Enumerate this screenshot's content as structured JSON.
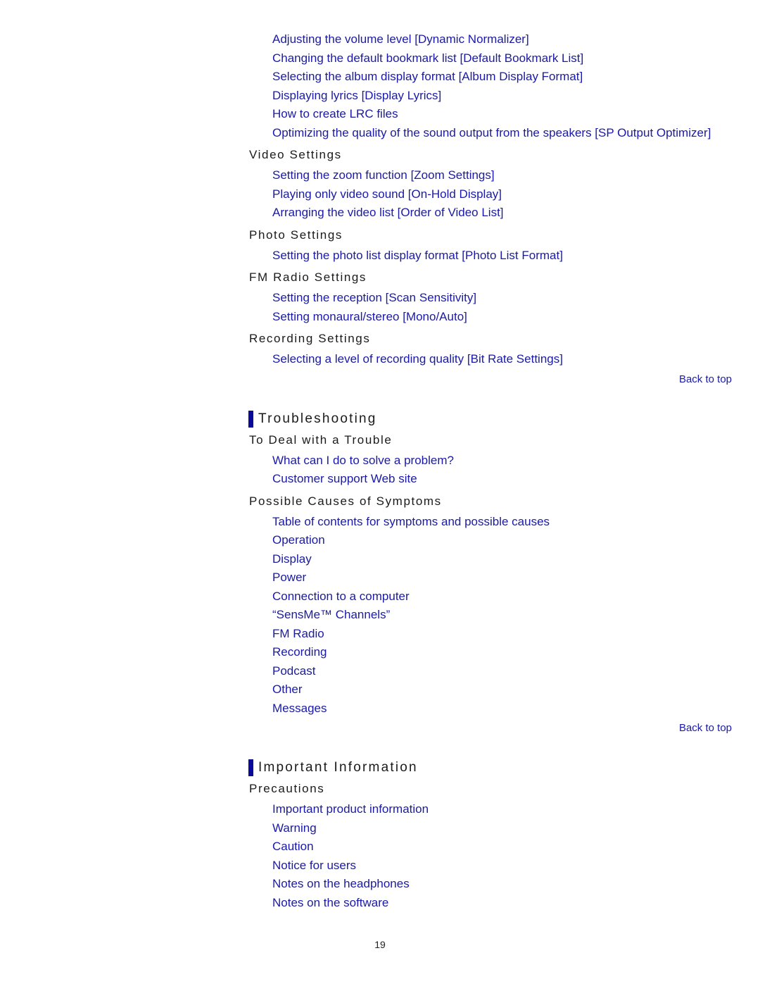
{
  "top_links": [
    "Adjusting the volume level [Dynamic Normalizer]",
    "Changing the default bookmark list [Default Bookmark List]",
    "Selecting the album display format [Album Display Format]",
    "Displaying lyrics [Display Lyrics]",
    "How to create LRC files",
    "Optimizing the quality of the sound output from the speakers [SP Output Optimizer]"
  ],
  "video": {
    "title": "Video Settings",
    "links": [
      "Setting the zoom function [Zoom Settings]",
      "Playing only video sound [On-Hold Display]",
      "Arranging the video list [Order of Video List]"
    ]
  },
  "photo": {
    "title": "Photo Settings",
    "links": [
      "Setting the photo list display format [Photo List Format]"
    ]
  },
  "fm": {
    "title": "FM Radio Settings",
    "links": [
      "Setting the reception [Scan Sensitivity]",
      "Setting monaural/stereo [Mono/Auto]"
    ]
  },
  "recording": {
    "title": "Recording Settings",
    "links": [
      "Selecting a level of recording quality [Bit Rate Settings]"
    ]
  },
  "back_to_top": "Back to top",
  "troubleshooting": {
    "title": "Troubleshooting",
    "deal": {
      "title": "To Deal with a Trouble",
      "links": [
        "What can I do to solve a problem?",
        "Customer support Web site"
      ]
    },
    "causes": {
      "title": "Possible Causes of Symptoms",
      "links": [
        "Table of contents for symptoms and possible causes",
        "Operation",
        "Display",
        "Power",
        "Connection to a computer",
        "“SensMe™ Channels”",
        "FM Radio",
        "Recording",
        "Podcast",
        "Other",
        "Messages"
      ]
    }
  },
  "important": {
    "title": "Important Information",
    "precautions": {
      "title": "Precautions",
      "links": [
        "Important product information",
        "Warning",
        "Caution",
        "Notice for users",
        "Notes on the headphones",
        "Notes on the software"
      ]
    }
  },
  "page_number": "19"
}
